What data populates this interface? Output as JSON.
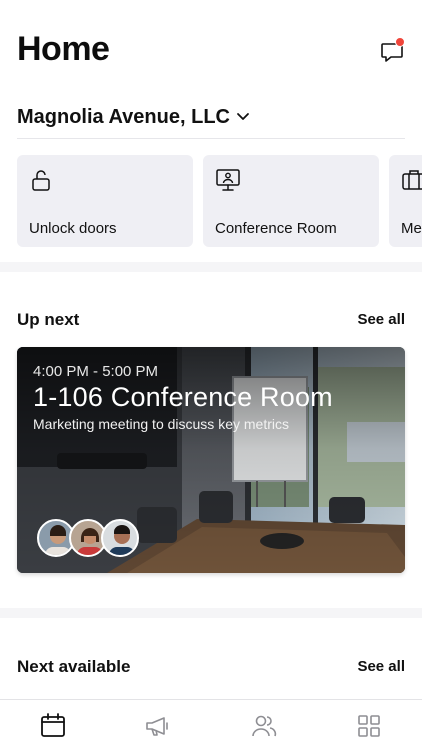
{
  "header": {
    "title": "Home",
    "message_icon": "chat-bubble-icon",
    "has_unread": true,
    "badge_color": "#f0453a"
  },
  "organization": {
    "name": "Magnolia Avenue, LLC",
    "icon": "chevron-down-icon"
  },
  "quick_actions": [
    {
      "label": "Unlock doors",
      "icon": "unlock-icon"
    },
    {
      "label": "Conference Room",
      "icon": "presentation-screen-icon"
    },
    {
      "label": "Me",
      "icon": "briefcase-icon"
    }
  ],
  "up_next": {
    "title": "Up next",
    "see_all": "See all",
    "event": {
      "time": "4:00 PM - 5:00 PM",
      "room": "1-106 Conference Room",
      "description": "Marketing meeting to discuss key metrics",
      "attendees": [
        "attendee-1",
        "attendee-2",
        "attendee-3"
      ]
    }
  },
  "next_available": {
    "title": "Next available",
    "see_all": "See all"
  },
  "tabbar": [
    {
      "name": "calendar",
      "icon": "calendar-icon",
      "active": true
    },
    {
      "name": "announcements",
      "icon": "megaphone-icon",
      "active": false
    },
    {
      "name": "people",
      "icon": "people-icon",
      "active": false
    },
    {
      "name": "apps",
      "icon": "grid-icon",
      "active": false
    }
  ]
}
